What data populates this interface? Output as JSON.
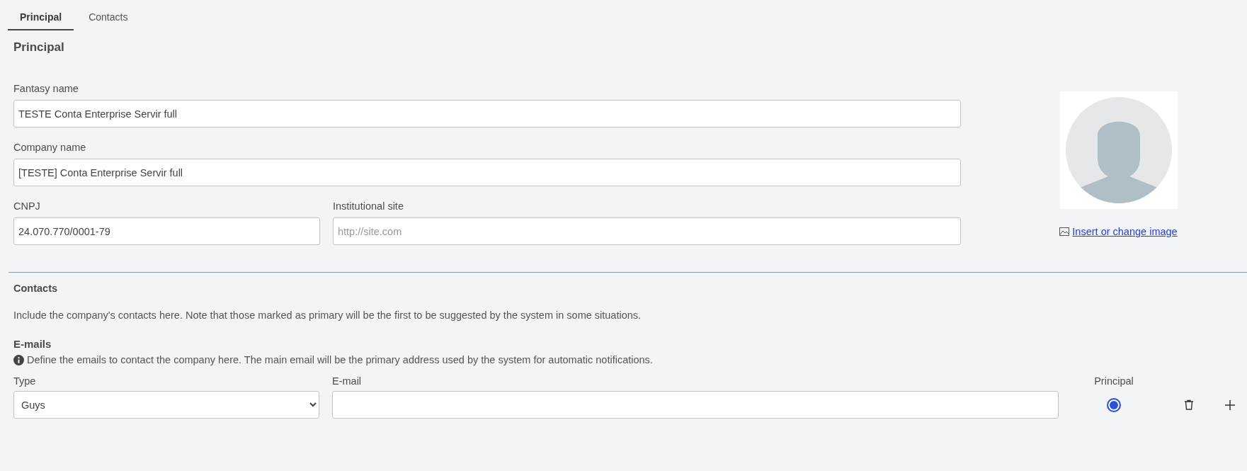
{
  "tabs": [
    {
      "label": "Principal",
      "selected": true
    },
    {
      "label": "Contacts",
      "selected": false
    }
  ],
  "principal": {
    "heading": "Principal",
    "field_rows": [
      [
        {
          "label": "Fantasy name",
          "value": "TESTE Conta Enterprise Servir full"
        }
      ],
      [
        {
          "label": "Company name",
          "value": "[TESTE] Conta Enterprise Servir full"
        }
      ],
      [
        {
          "label": "CNPJ",
          "value": "24.070.770/0001-79"
        },
        {
          "label": "Institutional site",
          "placeholder": "http://site.com"
        }
      ]
    ],
    "image_link": "Insert or change image"
  },
  "contacts": {
    "heading": "Contacts",
    "description": "Include the company's contacts here. Note that those marked as primary will be the first to be suggested by the system in some situations.",
    "emails": {
      "heading": "E-mails",
      "info": "Define the emails to contact the company here. The main email will be the primary address used by the system for automatic notifications.",
      "columns": {
        "type": "Type",
        "email": "E-mail",
        "principal": "Principal"
      },
      "rows": [
        {
          "type": "Guys",
          "principal": {
            "selected": true
          }
        }
      ]
    }
  }
}
